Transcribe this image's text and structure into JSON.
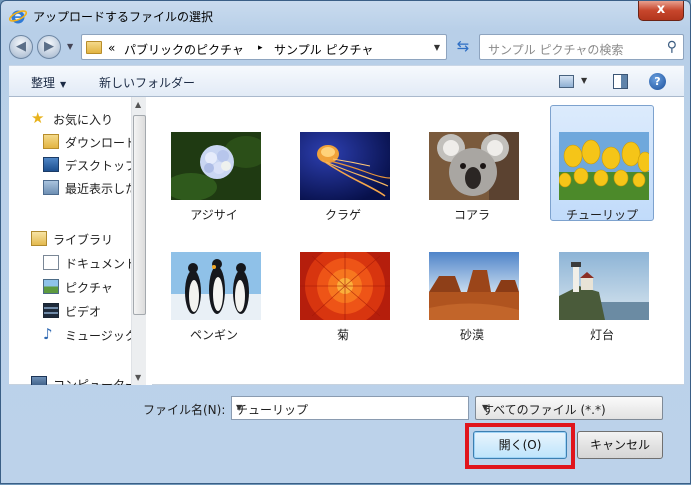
{
  "window": {
    "title": "アップロードするファイルの選択",
    "close_label": "x"
  },
  "nav": {
    "back_glyph": "◀",
    "forward_glyph": "▶",
    "address": {
      "chevron": "«",
      "segments": [
        "パブリックのピクチャ",
        "サンプル ピクチャ"
      ],
      "separator": "▸"
    },
    "search_placeholder": "サンプル ピクチャの検索"
  },
  "toolbar": {
    "organize_label": "整理",
    "new_folder_label": "新しいフォルダー",
    "help_label": "?"
  },
  "sidebar": {
    "favorites": {
      "label": "お気に入り",
      "items": [
        "ダウンロード",
        "デスクトップ",
        "最近表示した場所"
      ]
    },
    "libraries": {
      "label": "ライブラリ",
      "items": [
        "ドキュメント",
        "ピクチャ",
        "ビデオ",
        "ミュージック"
      ]
    },
    "computer": {
      "label": "コンピューター"
    }
  },
  "files": [
    {
      "name": "アジサイ",
      "selected": false
    },
    {
      "name": "クラゲ",
      "selected": false
    },
    {
      "name": "コアラ",
      "selected": false
    },
    {
      "name": "チューリップ",
      "selected": true
    },
    {
      "name": "ペンギン",
      "selected": false
    },
    {
      "name": "菊",
      "selected": false
    },
    {
      "name": "砂漠",
      "selected": false
    },
    {
      "name": "灯台",
      "selected": false
    }
  ],
  "footer": {
    "filename_label": "ファイル名(N):",
    "filename_value": "チューリップ",
    "filter_value": "すべてのファイル (*.*)",
    "open_label": "開く(O)",
    "cancel_label": "キャンセル"
  },
  "colors": {
    "highlight": "#e0141b",
    "selection": "#c1dbfa"
  }
}
